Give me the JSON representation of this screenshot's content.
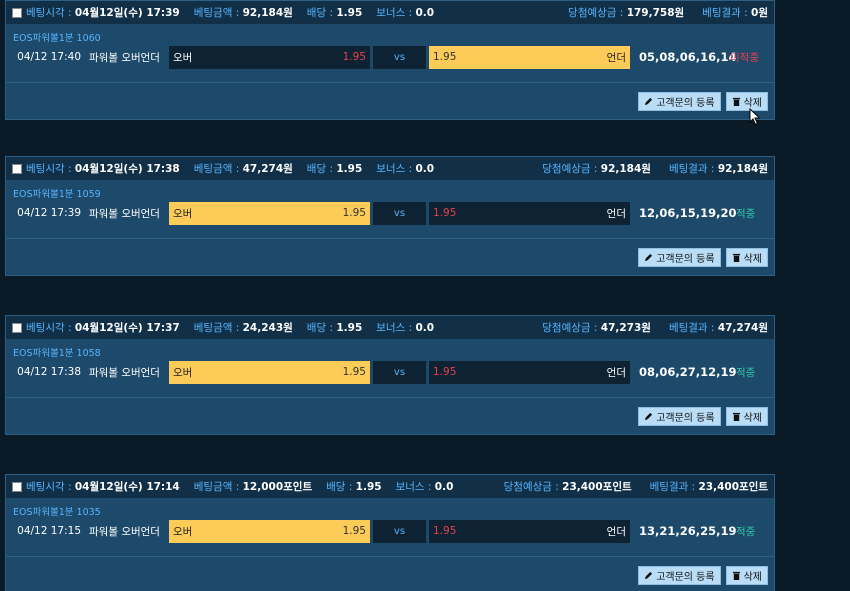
{
  "labels": {
    "bet_time": "베팅시각 : ",
    "bet_amount": "베팅금액 : ",
    "odds": "배당 : ",
    "bonus": "보너스 : ",
    "expected": "당첨예상금 : ",
    "result": "베팅결과 : ",
    "vs": "vs",
    "inquiry_button": "고객문의 등록",
    "delete_button": "삭제"
  },
  "bets": [
    {
      "bet_time": "04월12일(수) 17:39",
      "bet_amount": "92,184원",
      "odds": "1.95",
      "bonus": "0.0",
      "expected": "179,758원",
      "result": "0원",
      "round": "EOS파워볼1분 1060",
      "game_time": "04/12 17:40",
      "game_name": "파워볼 오버언더",
      "over_label": "오버",
      "over_odds": "1.95",
      "under_label": "언더",
      "under_odds": "1.95",
      "numbers": "05,08,06,16,14",
      "status": "미적중"
    },
    {
      "bet_time": "04월12일(수) 17:38",
      "bet_amount": "47,274원",
      "odds": "1.95",
      "bonus": "0.0",
      "expected": "92,184원",
      "result": "92,184원",
      "round": "EOS파워볼1분 1059",
      "game_time": "04/12 17:39",
      "game_name": "파워볼 오버언더",
      "over_label": "오버",
      "over_odds": "1.95",
      "under_label": "언더",
      "under_odds": "1.95",
      "numbers": "12,06,15,19,20",
      "status": "적중"
    },
    {
      "bet_time": "04월12일(수) 17:37",
      "bet_amount": "24,243원",
      "odds": "1.95",
      "bonus": "0.0",
      "expected": "47,273원",
      "result": "47,274원",
      "round": "EOS파워볼1분 1058",
      "game_time": "04/12 17:38",
      "game_name": "파워볼 오버언더",
      "over_label": "오버",
      "over_odds": "1.95",
      "under_label": "언더",
      "under_odds": "1.95",
      "numbers": "08,06,27,12,19",
      "status": "적중"
    },
    {
      "bet_time": "04월12일(수) 17:14",
      "bet_amount": "12,000포인트",
      "odds": "1.95",
      "bonus": "0.0",
      "expected": "23,400포인트",
      "result": "23,400포인트",
      "round": "EOS파워볼1분 1035",
      "game_time": "04/12 17:15",
      "game_name": "파워볼 오버언더",
      "over_label": "오버",
      "over_odds": "1.95",
      "under_label": "언더",
      "under_odds": "1.95",
      "numbers": "13,21,26,25,19",
      "status": "적중"
    }
  ]
}
